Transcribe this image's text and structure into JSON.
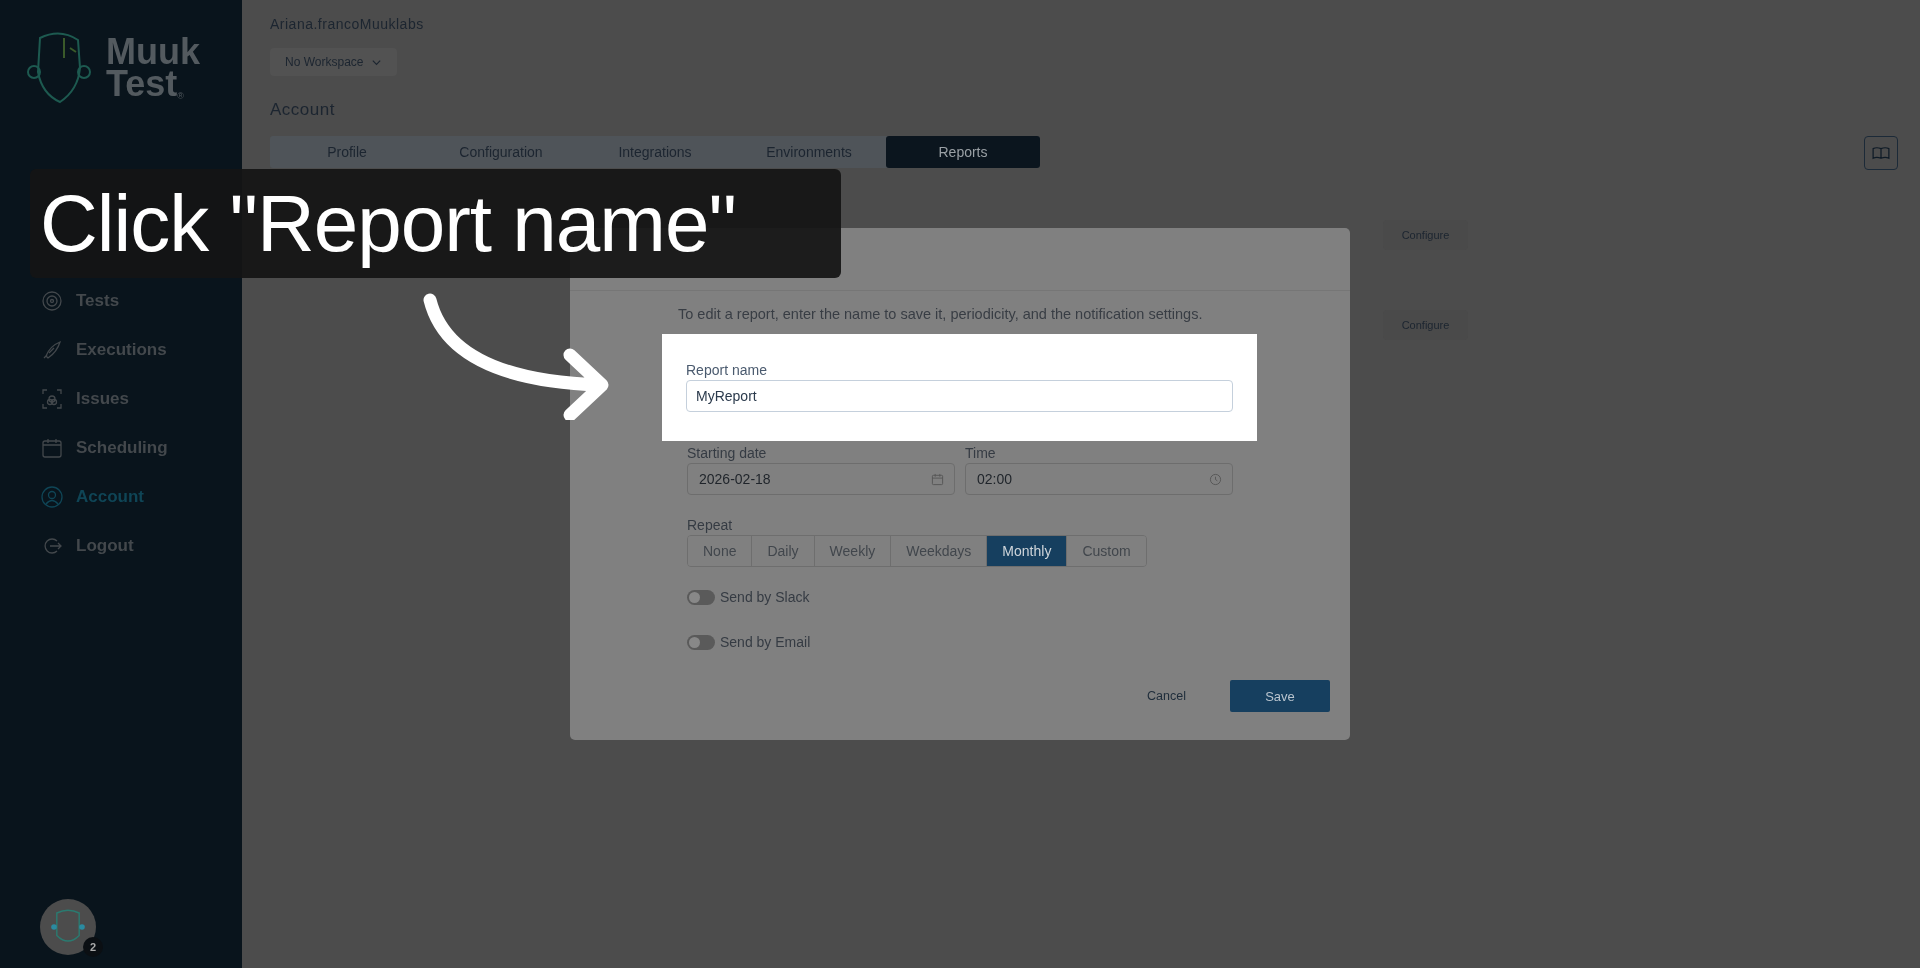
{
  "sidebar": {
    "logo": {
      "line_1": "Muuk",
      "line_2": "Test",
      "mark": "®"
    },
    "items": [
      {
        "label": "Tests",
        "selected": false
      },
      {
        "label": "Executions",
        "selected": false
      },
      {
        "label": "Issues",
        "selected": false
      },
      {
        "label": "Scheduling",
        "selected": false
      },
      {
        "label": "Account",
        "selected": true
      },
      {
        "label": "Logout",
        "selected": false
      }
    ],
    "avatar": {
      "badge": "2"
    }
  },
  "header": {
    "user": "Ariana.francoMuuklabs",
    "workspace": "No Workspace",
    "title": "Account"
  },
  "tabs": [
    {
      "label": "Profile",
      "selected": false
    },
    {
      "label": "Configuration",
      "selected": false
    },
    {
      "label": "Integrations",
      "selected": false
    },
    {
      "label": "Environments",
      "selected": false
    },
    {
      "label": "Reports",
      "selected": true
    }
  ],
  "configure_buttons": [
    "Configure",
    "Configure"
  ],
  "dialog": {
    "description": "To edit a report, enter the name to save it, periodicity, and the notification settings.",
    "name_field": {
      "label": "Report name",
      "value": "MyReport"
    },
    "date_field": {
      "label": "Starting date",
      "value": "2026-02-18"
    },
    "time_field": {
      "label": "Time",
      "value": "02:00"
    },
    "repeat": {
      "label": "Repeat",
      "options": [
        {
          "label": "None",
          "selected": false
        },
        {
          "label": "Daily",
          "selected": false
        },
        {
          "label": "Weekly",
          "selected": false
        },
        {
          "label": "Weekdays",
          "selected": false
        },
        {
          "label": "Monthly",
          "selected": true
        },
        {
          "label": "Custom",
          "selected": false
        }
      ]
    },
    "toggles": [
      {
        "label": "Send by Slack",
        "on": false
      },
      {
        "label": "Send by Email",
        "on": false
      }
    ],
    "cancel": "Cancel",
    "save": "Save"
  },
  "tutorial": {
    "caption": "Click \"Report name\""
  }
}
